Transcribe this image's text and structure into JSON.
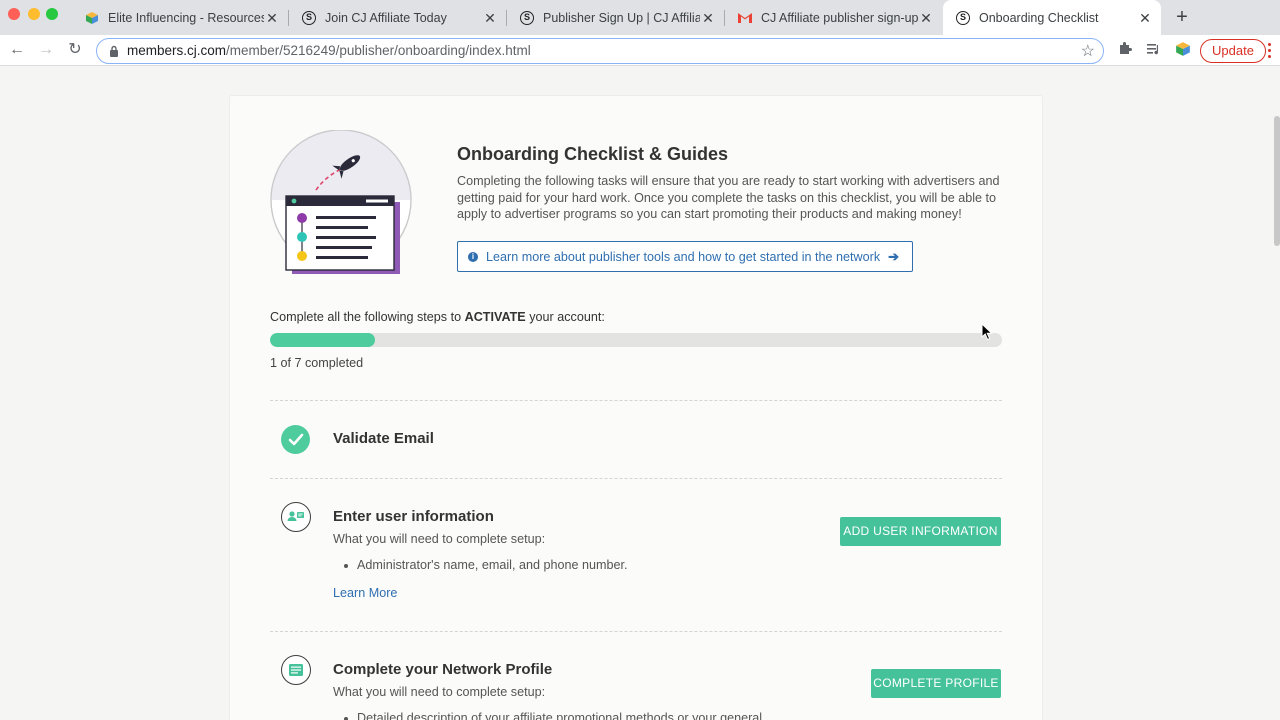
{
  "browser": {
    "tabs": [
      {
        "title": "Elite Influencing - Resources",
        "icon": "cube-icon"
      },
      {
        "title": "Join CJ Affiliate Today",
        "icon": "cj-logo-icon"
      },
      {
        "title": "Publisher Sign Up | CJ Affiliate",
        "icon": "cj-logo-icon"
      },
      {
        "title": "CJ Affiliate publisher sign-up -",
        "icon": "gmail-icon"
      },
      {
        "title": "Onboarding Checklist",
        "icon": "cj-logo-icon",
        "active": true
      }
    ],
    "url_domain": "members.cj.com",
    "url_path": "/member/5216249/publisher/onboarding/index.html",
    "update_label": "Update"
  },
  "page": {
    "heading": "Onboarding Checklist & Guides",
    "intro": "Completing the following tasks will ensure that you are ready to start working with advertisers and getting paid for your hard work. Once you complete the tasks on this checklist, you will be able to apply to advertiser programs so you can start promoting their products and making money!",
    "learn_more_button": "Learn more about publisher tools and how to get started in the network",
    "steps_label_prefix": "Complete all the following steps to ",
    "steps_label_emphasis": "ACTIVATE",
    "steps_label_suffix": " your account:",
    "progress": {
      "completed": 1,
      "total": 7,
      "text": "1 of 7 completed"
    },
    "accent_color": "#4ecc9e",
    "link_color": "#2f6fb0"
  },
  "tasks": [
    {
      "title": "Validate Email",
      "status": "completed"
    },
    {
      "title": "Enter user information",
      "subtitle": "What you will need to complete setup:",
      "bullets": [
        "Administrator's name, email, and phone number."
      ],
      "link": "Learn More",
      "button": "ADD USER INFORMATION",
      "icon": "user-card-icon"
    },
    {
      "title": "Complete your Network Profile",
      "subtitle": "What you will need to complete setup:",
      "bullets": [
        "Detailed description of your affiliate promotional methods or your general"
      ],
      "button": "COMPLETE PROFILE",
      "icon": "profile-list-icon"
    }
  ]
}
